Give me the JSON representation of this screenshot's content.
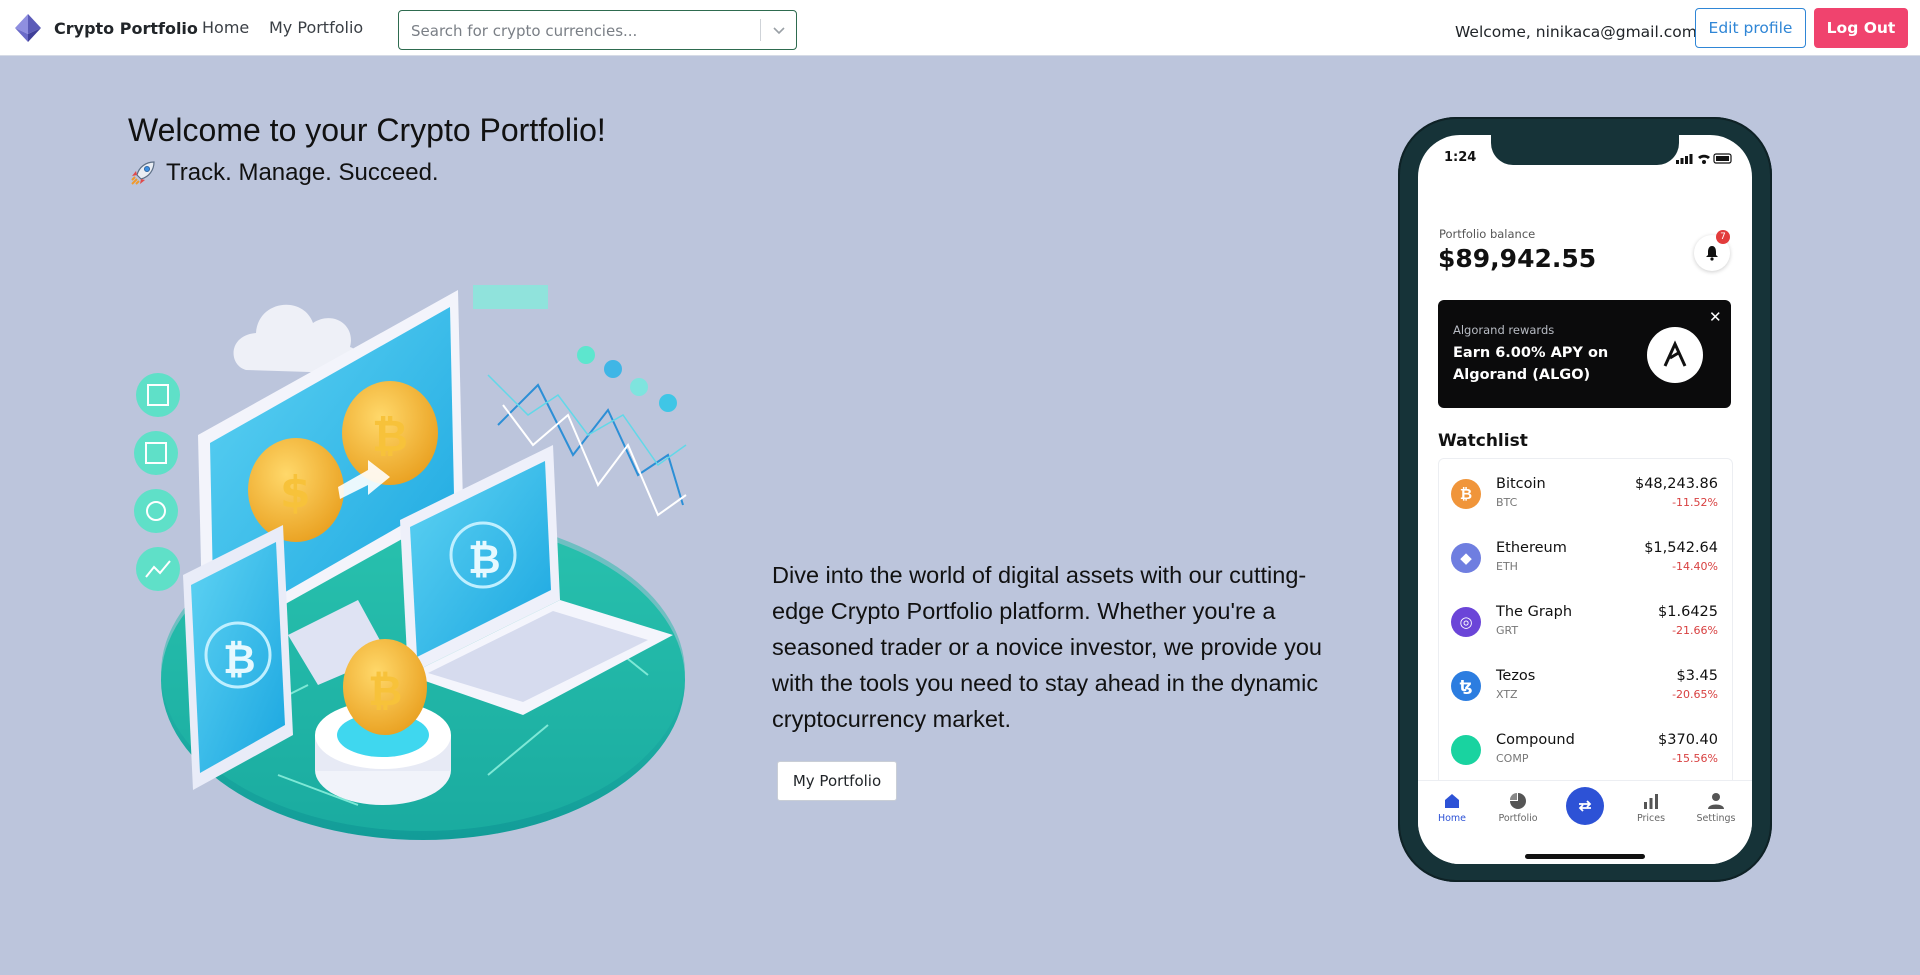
{
  "navbar": {
    "brand": "Crypto Portfolio",
    "links": [
      "Home",
      "My Portfolio"
    ],
    "search_placeholder": "Search for crypto currencies...",
    "welcome": "Welcome, ninikaca@gmail.com",
    "edit_profile": "Edit profile",
    "logout": "Log Out"
  },
  "hero": {
    "title": "Welcome to your Crypto Portfolio!",
    "subtitle": "Track. Manage. Succeed.",
    "description": "Dive into the world of digital assets with our cutting-edge Crypto Portfolio platform. Whether you're a seasoned trader or a novice investor, we provide you with the tools you need to stay ahead in the dynamic cryptocurrency market.",
    "cta": "My Portfolio"
  },
  "phone": {
    "time": "1:24",
    "balance_label": "Portfolio balance",
    "balance_value": "$89,942.55",
    "notification_count": "7",
    "banner": {
      "title": "Algorand rewards",
      "headline": "Earn 6.00% APY on Algorand (ALGO)"
    },
    "watchlist_title": "Watchlist",
    "watchlist": [
      {
        "name": "Bitcoin",
        "symbol": "BTC",
        "price": "$48,243.86",
        "change": "-11.52%",
        "color": "#f0953a",
        "glyph": "₿"
      },
      {
        "name": "Ethereum",
        "symbol": "ETH",
        "price": "$1,542.64",
        "change": "-14.40%",
        "color": "#6f7ee0",
        "glyph": "◆"
      },
      {
        "name": "The Graph",
        "symbol": "GRT",
        "price": "$1.6425",
        "change": "-21.66%",
        "color": "#6b45d8",
        "glyph": "◎"
      },
      {
        "name": "Tezos",
        "symbol": "XTZ",
        "price": "$3.45",
        "change": "-20.65%",
        "color": "#2c7de0",
        "glyph": "ꜩ"
      },
      {
        "name": "Compound",
        "symbol": "COMP",
        "price": "$370.40",
        "change": "-15.56%",
        "color": "#19d3a0",
        "glyph": ""
      }
    ],
    "tabs": [
      "Home",
      "Portfolio",
      "Prices",
      "Settings"
    ]
  },
  "colors": {
    "background": "#bcc5dc",
    "accent_blue": "#2f86d6",
    "logout": "#f0436e",
    "phone_active": "#2d52d6"
  }
}
